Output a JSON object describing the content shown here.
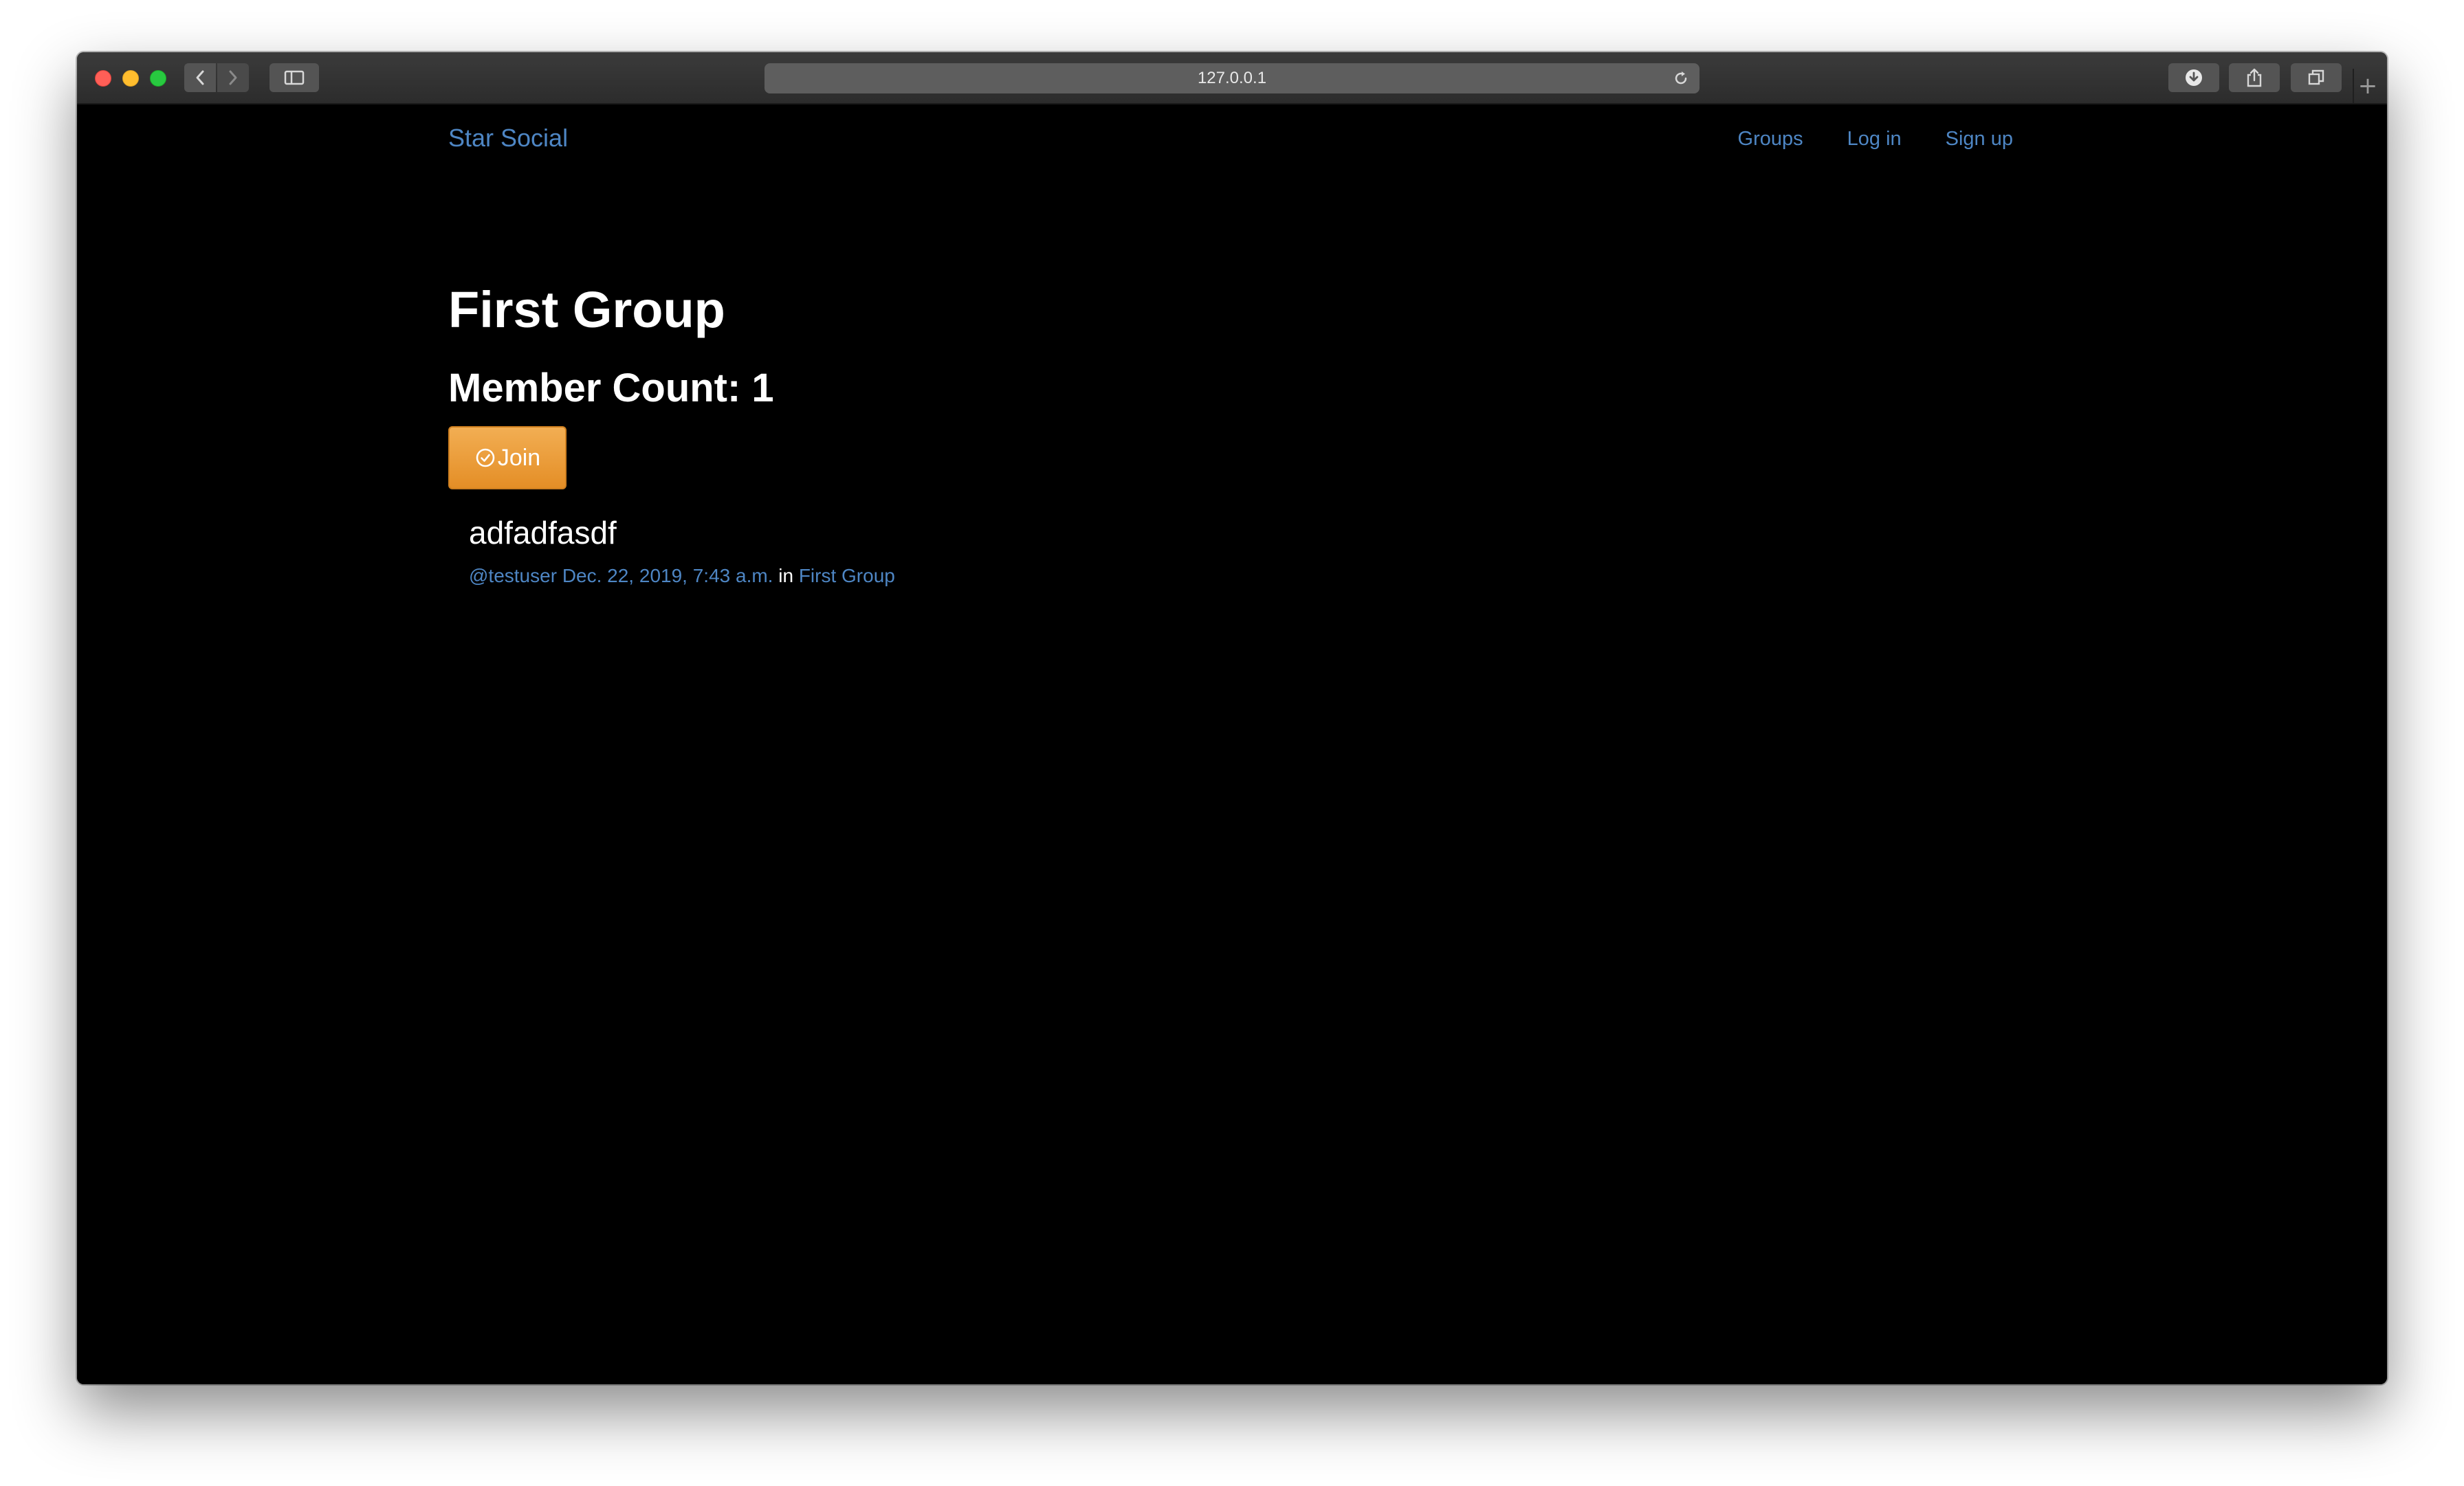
{
  "browser": {
    "url": "127.0.0.1"
  },
  "navbar": {
    "brand": "Star Social",
    "links": [
      "Groups",
      "Log in",
      "Sign up"
    ]
  },
  "group": {
    "title": "First Group",
    "member_count": "Member Count: 1",
    "join_label": "Join"
  },
  "post": {
    "text": "adfadfasdf",
    "author": "@testuser",
    "timestamp": "Dec. 22, 2019, 7:43 a.m.",
    "in_label": "in",
    "group_link": "First Group"
  },
  "colors": {
    "link": "#4e86c4",
    "join_button": "#e99a35",
    "background": "#000000"
  },
  "icons": {
    "join": "check-circle-icon"
  }
}
